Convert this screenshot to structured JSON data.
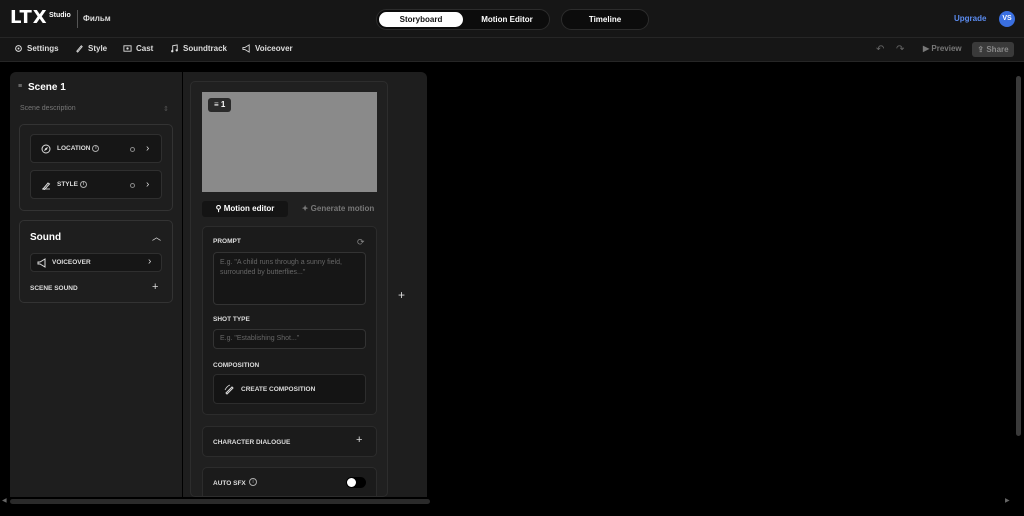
{
  "header": {
    "logo": "LTX",
    "logo_sub": "Studio",
    "project_name": "Фильм",
    "tabs": [
      {
        "label": "Storyboard",
        "active": true
      },
      {
        "label": "Motion Editor",
        "active": false
      }
    ],
    "timeline_label": "Timeline",
    "upgrade_label": "Upgrade",
    "avatar_initials": "VS"
  },
  "toolbar": {
    "items": [
      {
        "label": "Settings",
        "icon": "gear-icon"
      },
      {
        "label": "Style",
        "icon": "brush-icon"
      },
      {
        "label": "Cast",
        "icon": "cast-icon"
      },
      {
        "label": "Soundtrack",
        "icon": "music-icon"
      },
      {
        "label": "Voiceover",
        "icon": "megaphone-icon"
      }
    ],
    "undo_icon": "↶",
    "redo_icon": "↷",
    "preview_label": "Preview",
    "share_label": "Share"
  },
  "scene": {
    "title": "Scene 1",
    "description_placeholder": "Scene description",
    "location_label": "LOCATION",
    "style_label": "STYLE",
    "info_glyph": "i",
    "sound_title": "Sound",
    "voiceover_label": "VOICEOVER",
    "scene_sound_label": "SCENE SOUND"
  },
  "shot": {
    "number": "1",
    "tab_motion": "Motion editor",
    "tab_generate": "Generate motion",
    "prompt_label": "PROMPT",
    "prompt_placeholder": "E.g. \"A child runs through a sunny field, surrounded by butterflies...\"",
    "shot_type_label": "SHOT TYPE",
    "shot_type_placeholder": "E.g. \"Establishing Shot...\"",
    "composition_label": "COMPOSITION",
    "create_composition_label": "CREATE COMPOSITION",
    "character_dialogue_label": "CHARACTER DIALOGUE",
    "auto_sfx_label": "AUTO SFX",
    "auto_sfx_on": false
  },
  "colors": {
    "accent": "#3a6fe0",
    "upgrade": "#5b8cf0",
    "panel": "#1e1e1e",
    "background": "#000000"
  }
}
